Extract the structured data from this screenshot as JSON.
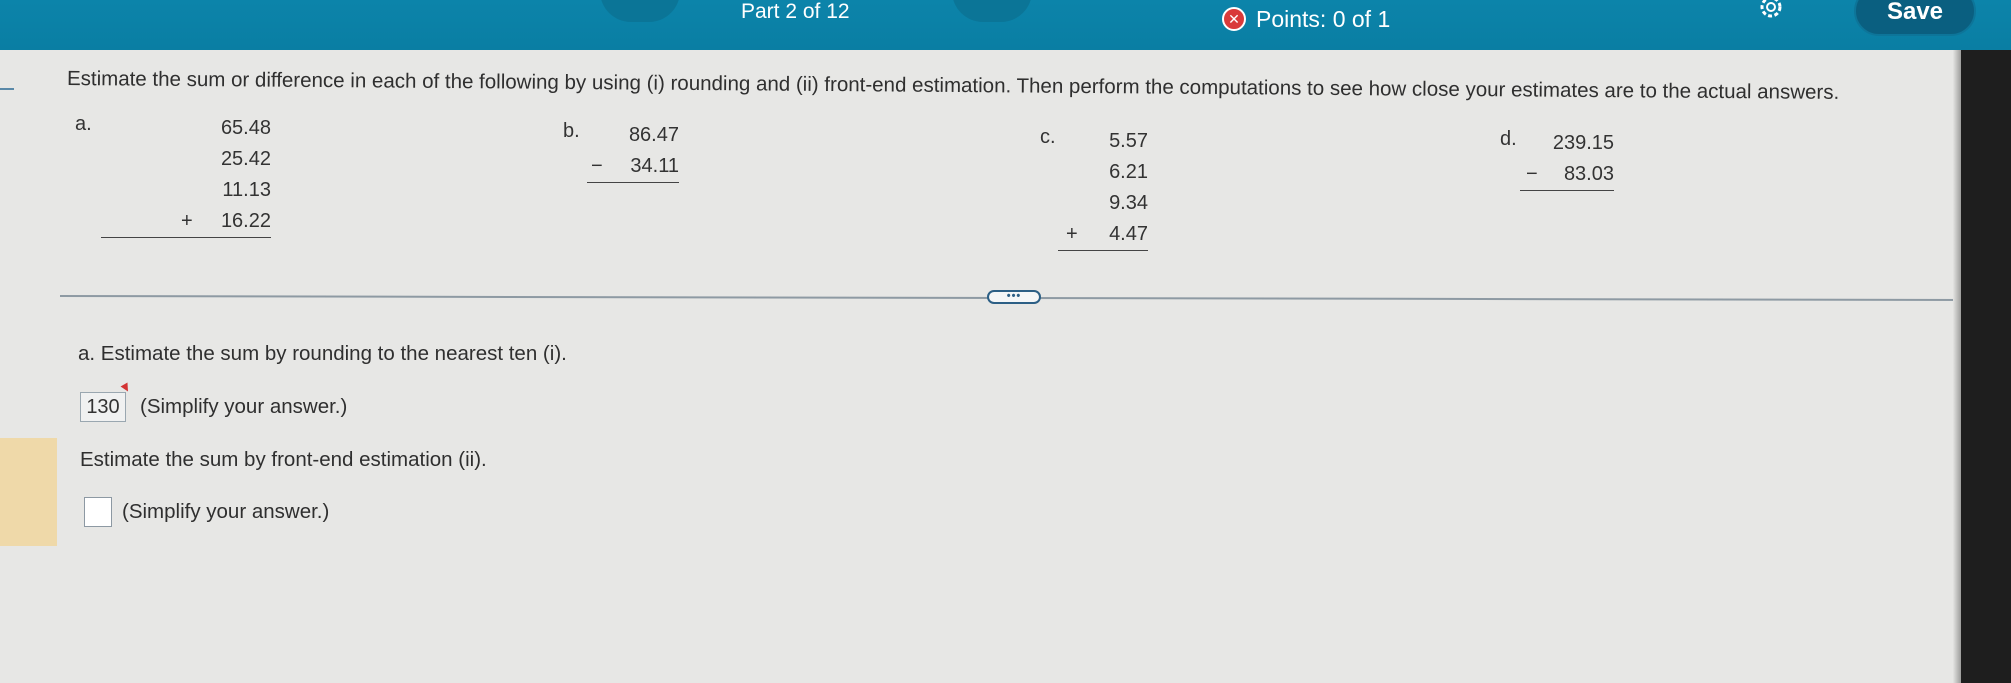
{
  "header": {
    "part_label": "Part 2 of 12",
    "points_label": "Points: 0 of 1",
    "save_label": "Save",
    "points_icon": "x-circle-icon",
    "settings_icon": "gear-icon"
  },
  "question": {
    "instructions": "Estimate the sum or difference in each of the following by using (i) rounding and (ii) front-end estimation. Then perform the computations to see how close your estimates are to the actual answers.",
    "problems": [
      {
        "letter": "a.",
        "operator": "+",
        "numbers": [
          "65.48",
          "25.42",
          "11.13",
          "16.22"
        ]
      },
      {
        "letter": "b.",
        "operator": "−",
        "numbers": [
          "86.47",
          "34.11"
        ]
      },
      {
        "letter": "c.",
        "operator": "+",
        "numbers": [
          "5.57",
          "6.21",
          "9.34",
          "4.47"
        ]
      },
      {
        "letter": "d.",
        "operator": "−",
        "numbers": [
          "239.15",
          "83.03"
        ]
      }
    ]
  },
  "more_button_label": "•••",
  "answer_section": {
    "part_a_prompt": "a. Estimate the sum by rounding to the nearest ten (i).",
    "answer_1_value": "130",
    "simplify_note_1": "(Simplify your answer.)",
    "part_a_prompt_2": "Estimate the sum by front-end estimation (ii).",
    "answer_2_value": "",
    "simplify_note_2": "(Simplify your answer.)"
  },
  "colors": {
    "header_bar": "#0c84aa",
    "save_button": "#0a5f80",
    "incorrect_mark": "#d93a3a",
    "page_background": "#e7e7e5",
    "left_highlight": "#efd9a9"
  }
}
